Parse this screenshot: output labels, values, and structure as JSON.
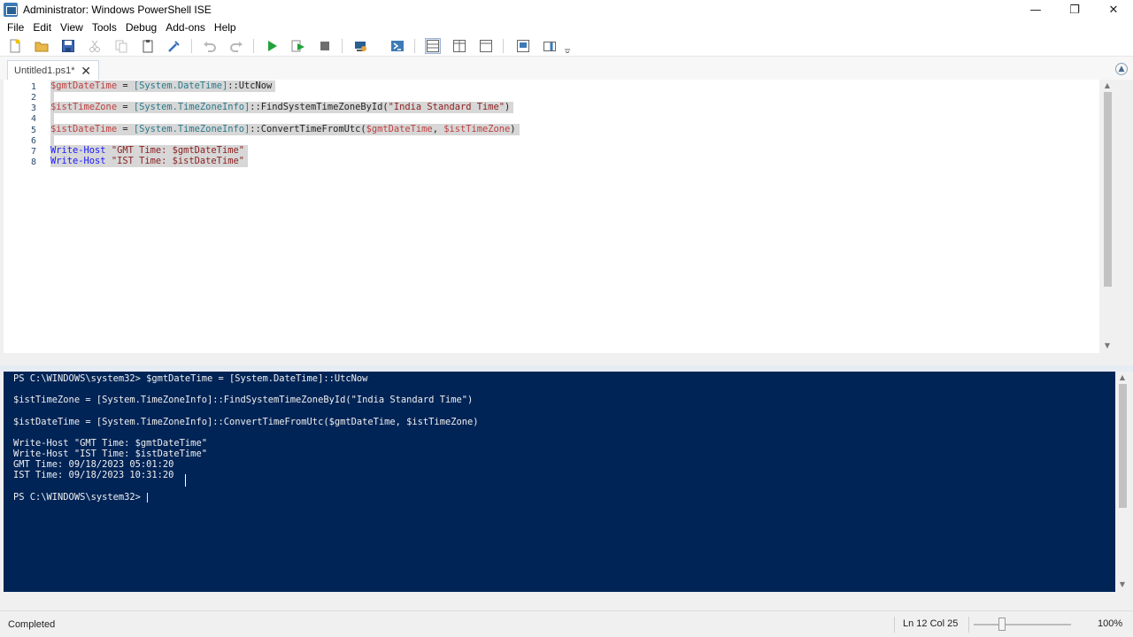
{
  "window": {
    "title": "Administrator: Windows PowerShell ISE",
    "controls": {
      "minimize": "—",
      "restore": "❐",
      "close": "✕"
    }
  },
  "menu": [
    "File",
    "Edit",
    "View",
    "Tools",
    "Debug",
    "Add-ons",
    "Help"
  ],
  "toolbar_icons": [
    "new-file-icon",
    "open-folder-icon",
    "save-icon",
    "cut-icon",
    "copy-icon",
    "paste-icon",
    "clear-console-icon",
    "undo-icon",
    "redo-icon",
    "run-script-icon",
    "run-selection-icon",
    "stop-icon",
    "remote-powershell-icon",
    "start-powershell-icon",
    "show-script-top-icon",
    "show-script-right-icon",
    "show-script-max-icon",
    "show-command-window-icon",
    "show-command-addon-icon"
  ],
  "tabs": [
    {
      "label": "Untitled1.ps1*",
      "close": "✕"
    }
  ],
  "editor": {
    "line_numbers": [
      "1",
      "2",
      "3",
      "4",
      "5",
      "6",
      "7",
      "8"
    ],
    "lines": {
      "l1": {
        "var": "$gmtDateTime",
        "eq": " = ",
        "type": "[System.DateTime]",
        "member": "::UtcNow"
      },
      "l3": {
        "var": "$istTimeZone",
        "eq": " = ",
        "type": "[System.TimeZoneInfo]",
        "member": "::FindSystemTimeZoneById(",
        "str": "\"India Standard Time\"",
        "close": ")"
      },
      "l5": {
        "var": "$istDateTime",
        "eq": " = ",
        "type": "[System.TimeZoneInfo]",
        "member": "::ConvertTimeFromUtc(",
        "arg1": "$gmtDateTime",
        "comma": ", ",
        "arg2": "$istTimeZone",
        "close": ")"
      },
      "l7": {
        "cmd": "Write-Host",
        "sp": " ",
        "str": "\"GMT Time: $gmtDateTime\""
      },
      "l8": {
        "cmd": "Write-Host",
        "sp": " ",
        "str": "\"IST Time: $istDateTime\""
      }
    }
  },
  "console": {
    "lines": [
      "PS C:\\WINDOWS\\system32> $gmtDateTime = [System.DateTime]::UtcNow",
      "$istTimeZone = [System.TimeZoneInfo]::FindSystemTimeZoneById(\"India Standard Time\")",
      "$istDateTime = [System.TimeZoneInfo]::ConvertTimeFromUtc($gmtDateTime, $istTimeZone)",
      "Write-Host \"GMT Time: $gmtDateTime\"",
      "Write-Host \"IST Time: $istDateTime\"",
      "GMT Time: 09/18/2023 05:01:20",
      "IST Time: 09/18/2023 10:31:20"
    ],
    "prompt": "PS C:\\WINDOWS\\system32> "
  },
  "status": {
    "text": "Completed",
    "position": "Ln 12  Col 25",
    "zoom": "100%"
  },
  "colors": {
    "console_bg": "#012456",
    "variable": "#c04040",
    "type": "#2a7a8a",
    "cmdlet": "#1a1aff",
    "string": "#8b1f1f"
  }
}
